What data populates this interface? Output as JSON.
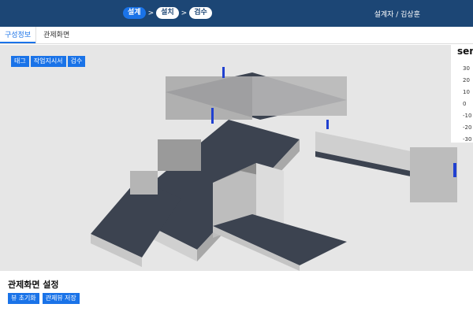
{
  "header": {
    "steps": [
      {
        "label": "설계",
        "active": true
      },
      {
        "label": "설치",
        "active": false
      },
      {
        "label": "검수",
        "active": false
      }
    ],
    "separator": ">",
    "user_label": "설계자 / 김상훈"
  },
  "tabs": [
    {
      "label": "구성정보",
      "active": true
    },
    {
      "label": "관제화면",
      "active": false
    }
  ],
  "viewer": {
    "buttons": [
      "태그",
      "작업지시서",
      "검수"
    ]
  },
  "sensor_panel": {
    "title": "sen",
    "ticks": [
      "30",
      "20",
      "10",
      "0",
      "-10",
      "-20",
      "-30"
    ]
  },
  "settings": {
    "title": "관제화면 설정",
    "buttons": [
      "뷰 초기화",
      "관제뷰 저장"
    ]
  },
  "colors": {
    "header_bg": "#1c4675",
    "accent": "#1a73e8",
    "viewport_bg": "#e6e6e6",
    "floor": "#3c4350",
    "wall": "#c9c9c9"
  }
}
